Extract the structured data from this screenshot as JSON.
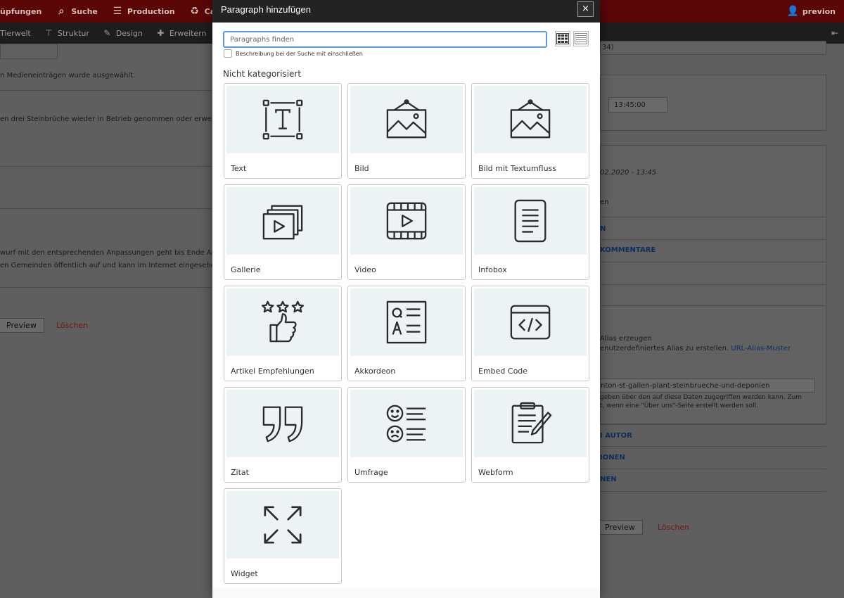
{
  "topbar": {
    "items": [
      {
        "label": "üpfungen",
        "icon": "link-icon"
      },
      {
        "label": "Suche",
        "icon": "search-icon"
      },
      {
        "label": "Production",
        "icon": "server-icon"
      },
      {
        "label": "Cache ne",
        "icon": "recycle-icon"
      }
    ],
    "user": "previon"
  },
  "subbar": {
    "items": [
      {
        "label": "Tierwelt",
        "icon": "content-icon"
      },
      {
        "label": "Struktur",
        "icon": "sitemap-icon"
      },
      {
        "label": "Design",
        "icon": "wrench-icon"
      },
      {
        "label": "Erweitern",
        "icon": "puzzle-icon"
      }
    ]
  },
  "background": {
    "left_text_media": "n Medieneinträgen wurde ausgewählt.",
    "left_text_quarry": "en drei Steinbrüche wieder in Betrieb genommen oder erweitert",
    "left_text_draft1": "wurf mit den entsprechenden Anpassungen geht bis Ende April in",
    "left_text_draft2": "en Gemeinden öffentlich auf und kann im Internet eingesehen w",
    "preview": "Preview",
    "delete": "Löschen",
    "right_field_value": "34)",
    "time_value": "13:45:00",
    "date_text": "02.2020 - 13:45",
    "right_text_en": "en",
    "right_link_n": "N",
    "right_link_comments": "KOMMENTARE",
    "alias_title": "Alias erzeugen",
    "alias_desc_prefix": "enutzerdefiniertes Alias zu erstellen.",
    "alias_link": "URL-Alias-Muster",
    "alias_value": "nton-st-gallen-plant-steinbrueche-und-deponien",
    "alias_note1": "geben über den auf diese Daten zugegriffen werden kann. Zum",
    "alias_note2": "t, wenn eine \"Über uns\"-Seite erstellt werden soll.",
    "right_link_author": "I AUTOR",
    "right_link_ionen": "IONEN",
    "right_link_nen": "NEN",
    "preview_right": "Preview",
    "delete_right": "Löschen"
  },
  "modal": {
    "title": "Paragraph hinzufügen",
    "close": "×",
    "search_placeholder": "Paragraphs finden",
    "checkbox_label": "Beschreibung bei der Suche mit einschließen",
    "category": "Nicht kategorisiert",
    "items": [
      {
        "label": "Text",
        "icon": "text-icon"
      },
      {
        "label": "Bild",
        "icon": "image-icon"
      },
      {
        "label": "Bild mit Textumfluss",
        "icon": "image-text-icon"
      },
      {
        "label": "Gallerie",
        "icon": "gallery-icon"
      },
      {
        "label": "Video",
        "icon": "video-icon"
      },
      {
        "label": "Infobox",
        "icon": "infobox-icon"
      },
      {
        "label": "Artikel Empfehlungen",
        "icon": "recommendation-icon"
      },
      {
        "label": "Akkordeon",
        "icon": "accordion-icon"
      },
      {
        "label": "Embed Code",
        "icon": "embed-code-icon"
      },
      {
        "label": "Zitat",
        "icon": "quote-icon"
      },
      {
        "label": "Umfrage",
        "icon": "survey-icon"
      },
      {
        "label": "Webform",
        "icon": "webform-icon"
      },
      {
        "label": "Widget",
        "icon": "widget-icon"
      }
    ]
  },
  "colors": {
    "topbar": "#5a0606",
    "subbar": "#1d1d1d",
    "modal_header": "#232323",
    "card_art": "#edf2f4",
    "search_focus": "#5b9bd5",
    "icon_stroke": "#2b2b2b"
  }
}
